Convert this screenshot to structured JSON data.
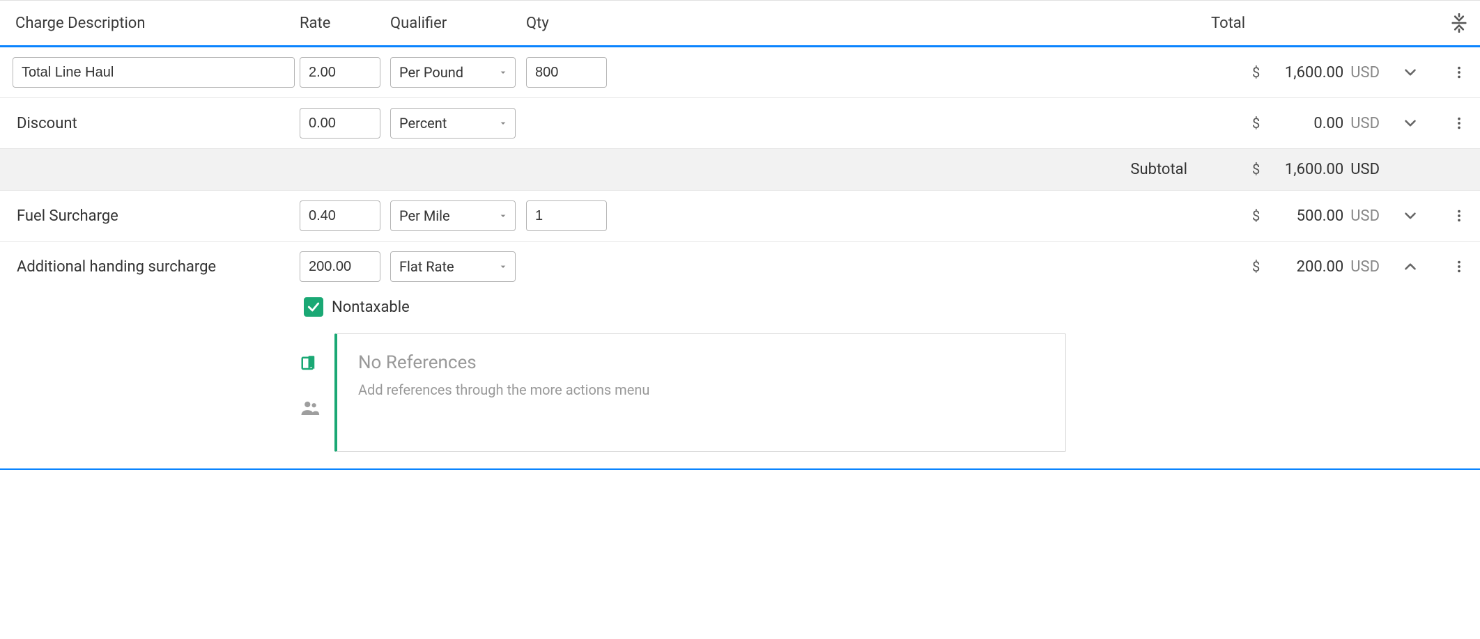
{
  "headers": {
    "desc": "Charge Description",
    "rate": "Rate",
    "qualifier": "Qualifier",
    "qty": "Qty",
    "total": "Total"
  },
  "rows": [
    {
      "desc": "Total Line Haul",
      "desc_editable": true,
      "rate": "2.00",
      "qualifier": "Per Pound",
      "qty": "800",
      "has_qty": true,
      "symbol": "$",
      "amount": "1,600.00",
      "currency": "USD",
      "expanded": false
    },
    {
      "desc": "Discount",
      "desc_editable": false,
      "rate": "0.00",
      "qualifier": "Percent",
      "qty": "",
      "has_qty": false,
      "symbol": "$",
      "amount": "0.00",
      "currency": "USD",
      "expanded": false
    }
  ],
  "subtotal": {
    "label": "Subtotal",
    "symbol": "$",
    "amount": "1,600.00",
    "currency": "USD"
  },
  "rows2": [
    {
      "desc": "Fuel Surcharge",
      "desc_editable": false,
      "rate": "0.40",
      "qualifier": "Per Mile",
      "qty": "1",
      "has_qty": true,
      "symbol": "$",
      "amount": "500.00",
      "currency": "USD",
      "expanded": false
    },
    {
      "desc": "Additional handing surcharge",
      "desc_editable": false,
      "rate": "200.00",
      "qualifier": "Flat Rate",
      "qty": "",
      "has_qty": false,
      "symbol": "$",
      "amount": "200.00",
      "currency": "USD",
      "expanded": true
    }
  ],
  "detail": {
    "nontaxable_label": "Nontaxable",
    "nontaxable_checked": true,
    "ref_title": "No References",
    "ref_sub": "Add references through the more actions menu"
  }
}
